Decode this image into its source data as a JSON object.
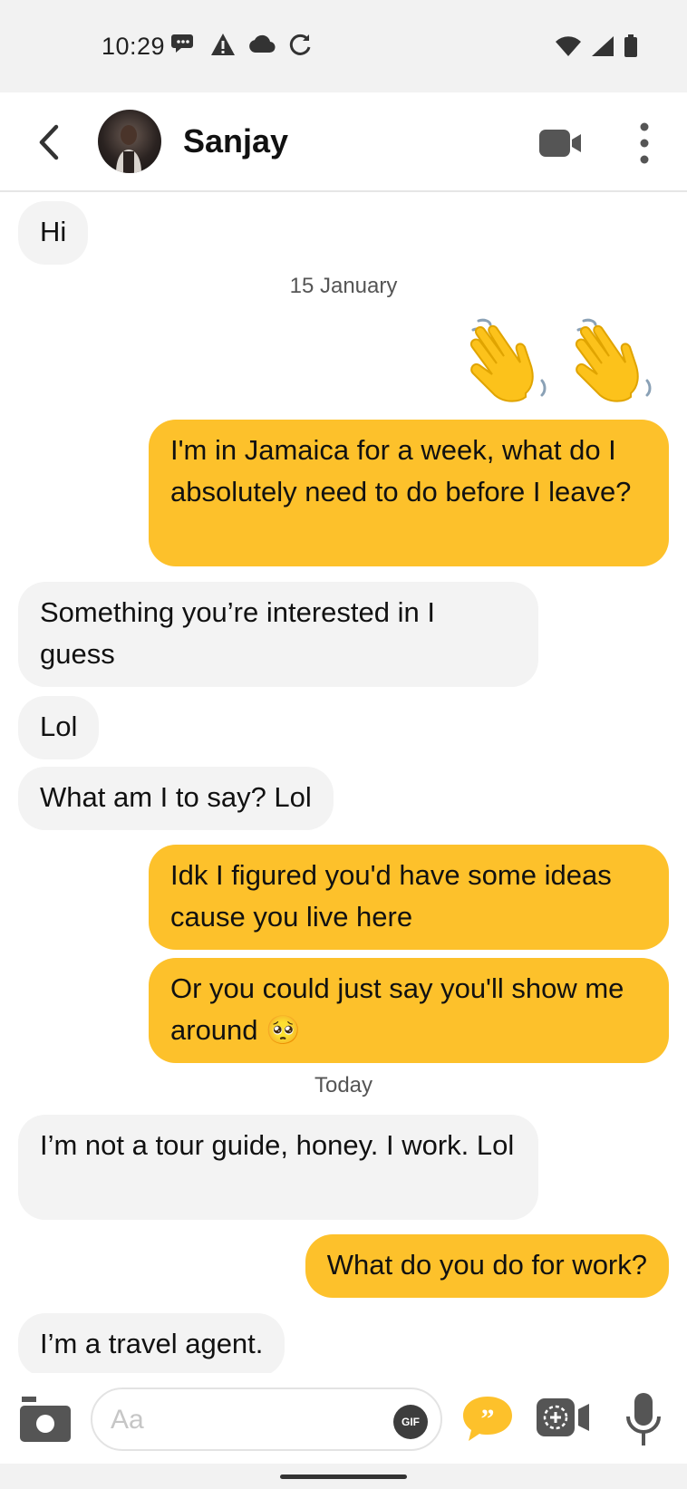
{
  "status_bar": {
    "time": "10:29",
    "left_icons": [
      "chat-notification-icon",
      "warning-icon",
      "cloud-icon",
      "sync-icon"
    ],
    "right_icons": [
      "wifi-icon",
      "signal-icon",
      "battery-icon"
    ]
  },
  "header": {
    "contact_name": "Sanjay",
    "back_icon": "chevron-left-icon",
    "video_icon": "video-call-icon",
    "more_icon": "more-vertical-icon"
  },
  "messages": [
    {
      "direction": "in",
      "text": "Hi"
    },
    {
      "type": "date",
      "text": "15 January"
    },
    {
      "direction": "out",
      "type": "emoji",
      "text": "👋 👋"
    },
    {
      "direction": "out",
      "text": "I'm in Jamaica for a week, what do I absolutely need to do before I leave?"
    },
    {
      "direction": "in",
      "text": "Something you’re interested in I guess"
    },
    {
      "direction": "in",
      "text": "Lol"
    },
    {
      "direction": "in",
      "text": "What am I to say? Lol"
    },
    {
      "direction": "out",
      "text": "Idk I figured you'd have some ideas cause you live here"
    },
    {
      "direction": "out",
      "text": "Or you could just say you'll show me around 🥺"
    },
    {
      "type": "date",
      "text": "Today"
    },
    {
      "direction": "in",
      "text": "I’m not a tour guide, honey. I work. Lol"
    },
    {
      "direction": "out",
      "text": "What do you do for work?"
    },
    {
      "direction": "in",
      "text": "I’m a travel agent."
    }
  ],
  "composer": {
    "placeholder": "Aa",
    "gif_label": "GIF",
    "camera_icon": "camera-icon",
    "quote_icon": "quote-bubble-icon",
    "story_icon": "video-story-icon",
    "mic_icon": "microphone-icon"
  },
  "colors": {
    "outgoing_bubble": "#fdc12b",
    "incoming_bubble": "#f3f3f3",
    "status_bar_bg": "#f2f2f2"
  }
}
